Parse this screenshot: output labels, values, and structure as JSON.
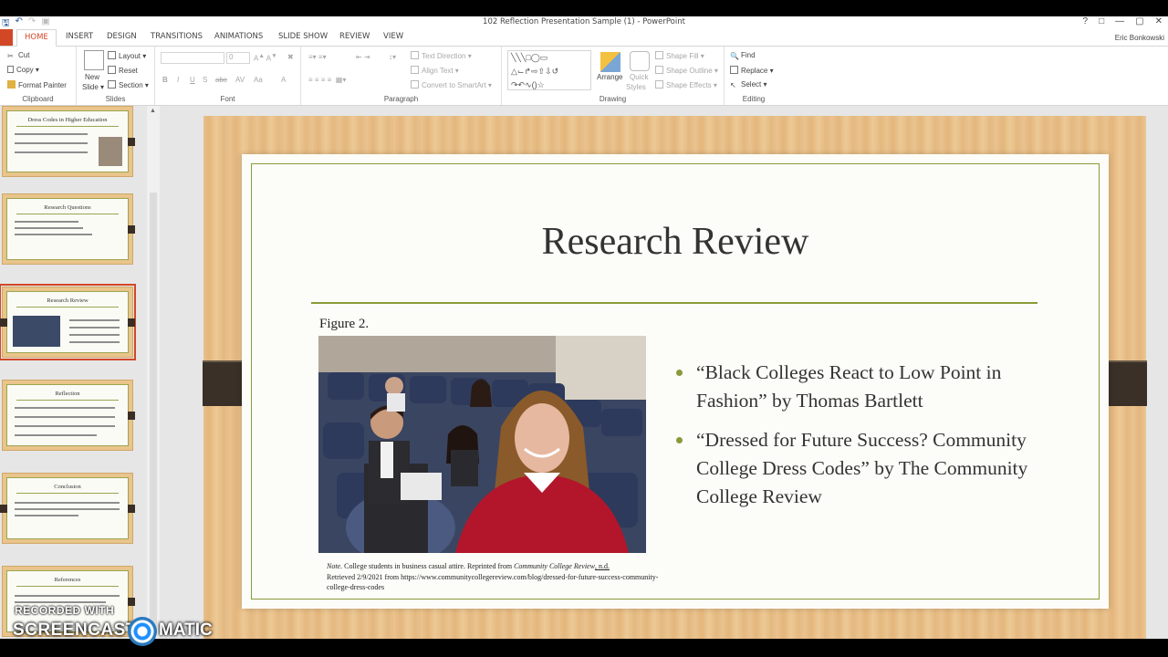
{
  "window": {
    "title": "102 Reflection Presentation Sample (1) - PowerPoint",
    "user": "Eric Bonkowski"
  },
  "tabs": [
    "HOME",
    "INSERT",
    "DESIGN",
    "TRANSITIONS",
    "ANIMATIONS",
    "SLIDE SHOW",
    "REVIEW",
    "VIEW"
  ],
  "ribbon": {
    "clipboard": {
      "cut": "Cut",
      "copy": "Copy",
      "format_painter": "Format Painter",
      "label": "Clipboard"
    },
    "slides": {
      "new_slide": "New",
      "new_slide_2": "Slide",
      "layout": "Layout",
      "reset": "Reset",
      "section": "Section",
      "label": "Slides"
    },
    "font": {
      "size": "0",
      "label": "Font"
    },
    "paragraph": {
      "text_direction": "Text Direction",
      "align_text": "Align Text",
      "smartart": "Convert to SmartArt",
      "label": "Paragraph"
    },
    "drawing": {
      "arrange": "Arrange",
      "quick": "Quick",
      "styles": "Styles",
      "shape_fill": "Shape Fill",
      "shape_outline": "Shape Outline",
      "shape_effects": "Shape Effects",
      "label": "Drawing"
    },
    "editing": {
      "find": "Find",
      "replace": "Replace",
      "select": "Select",
      "label": "Editing"
    }
  },
  "thumbnails": [
    {
      "title": "Dress Codes in Higher Education"
    },
    {
      "title": "Research Questions"
    },
    {
      "title": "Research Review"
    },
    {
      "title": "Reflection"
    },
    {
      "title": "Conclusion"
    },
    {
      "title": "References"
    }
  ],
  "slide": {
    "title": "Research Review",
    "figure_label": "Figure 2.",
    "note_prefix": "Note.",
    "note_text": " College students in business casual attire. Reprinted from ",
    "note_source": "Community College Review",
    "note_nd": ", n.d.",
    "note_retrieved": "Retrieved 2/9/2021 from https://www.communitycollegereview.com/blog/dressed-for-future-success-community-college-dress-codes",
    "bullets": [
      "“Black Colleges React to Low Point in Fashion” by Thomas Bartlett",
      "“Dressed for Future Success? Community College Dress Codes” by The Community College Review"
    ]
  },
  "watermark": {
    "line1": "RECORDED WITH",
    "line2": "SCREENCAST",
    "line3": "MATIC"
  },
  "colors": {
    "accent": "#d24726",
    "slide_green": "#8a9a3a",
    "wood": "#e9c08a"
  }
}
